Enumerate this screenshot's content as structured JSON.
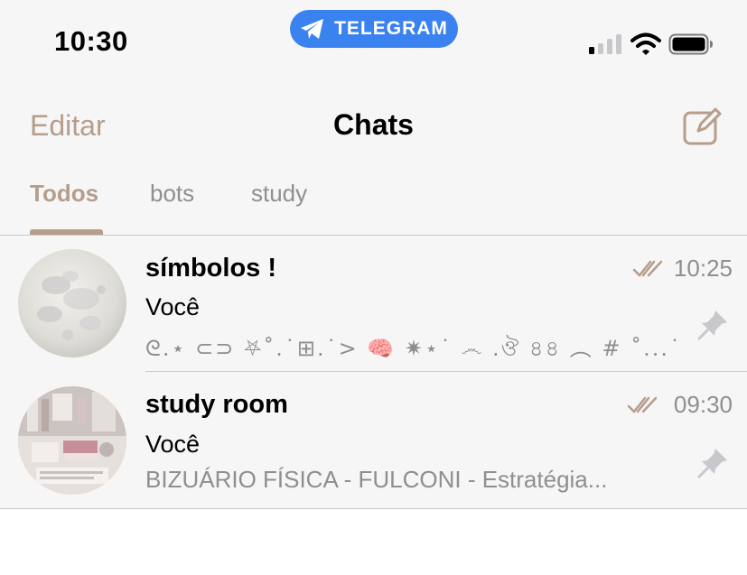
{
  "status_bar": {
    "time": "10:30",
    "banner_label": "TELEGRAM",
    "signal_icon": "cellular-signal-icon",
    "wifi_icon": "wifi-icon",
    "battery_icon": "battery-icon"
  },
  "nav": {
    "edit_label": "Editar",
    "title": "Chats",
    "compose_icon": "compose-icon"
  },
  "tabs": [
    {
      "label": "Todos",
      "active": true
    },
    {
      "label": "bots",
      "active": false
    },
    {
      "label": "study",
      "active": false
    }
  ],
  "chats": [
    {
      "name": "símbolos !",
      "time": "10:25",
      "sender": "Você",
      "preview": "ᘓ.⋆ ⊂⊃ ⛧˚.˙⊞.˙> 🧠 ✷⋆˙ ෴ .ঔ ৪৪ ︵ # ˚...˙",
      "read": true,
      "pinned": true
    },
    {
      "name": "study room",
      "time": "09:30",
      "sender": "Você",
      "preview": "BIZUÁRIO FÍSICA - FULCONI - Estratégia...",
      "read": true,
      "pinned": true
    }
  ],
  "colors": {
    "accent": "#b69d8c",
    "banner": "#3b82f1",
    "secondary_text": "#8e8e93",
    "background": "#f6f6f6"
  }
}
